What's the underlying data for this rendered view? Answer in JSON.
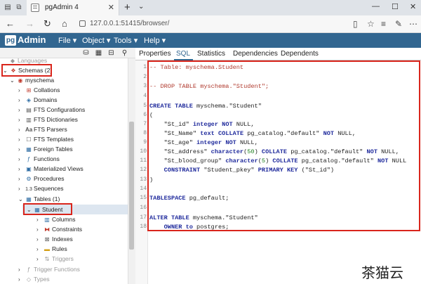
{
  "browser": {
    "tab_title": "pgAdmin 4",
    "url": "127.0.0.1:51415/browser/"
  },
  "app": {
    "logo_box": "pg",
    "logo_text": "Admin",
    "menus": [
      "File",
      "Object",
      "Tools",
      "Help"
    ]
  },
  "tree": {
    "top_item": "Languages",
    "schemas_label": "Schemas (2)",
    "schema_name": "myschema",
    "items": [
      {
        "label": "Collations",
        "icon": "collation-icon"
      },
      {
        "label": "Domains",
        "icon": "domain-icon"
      },
      {
        "label": "FTS Configurations",
        "icon": "fts-config-icon"
      },
      {
        "label": "FTS Dictionaries",
        "icon": "fts-dict-icon"
      },
      {
        "label": "FTS Parsers",
        "icon": "fts-parser-icon"
      },
      {
        "label": "FTS Templates",
        "icon": "fts-template-icon"
      },
      {
        "label": "Foreign Tables",
        "icon": "foreign-table-icon"
      },
      {
        "label": "Functions",
        "icon": "function-icon"
      },
      {
        "label": "Materialized Views",
        "icon": "mview-icon"
      },
      {
        "label": "Procedures",
        "icon": "procedure-icon"
      },
      {
        "label": "Sequences",
        "icon": "sequence-icon"
      }
    ],
    "tables_label": "Tables (1)",
    "table_name": "Student",
    "table_children": [
      "Columns",
      "Constraints",
      "Indexes",
      "Rules",
      "Triggers"
    ],
    "bottom_items": [
      "Trigger Functions",
      "Types"
    ]
  },
  "panel": {
    "tabs": [
      "Properties",
      "SQL",
      "Statistics",
      "Dependencies",
      "Dependents"
    ],
    "active_tab": "SQL"
  },
  "sql": {
    "line_numbers": [
      "1",
      "2",
      "3",
      "4",
      "5",
      "6",
      "7",
      "8",
      "9",
      "10",
      "11",
      "12",
      "13",
      "14",
      "15",
      "16",
      "17",
      "18"
    ],
    "line1": "-- Table: myschema.Student",
    "line3": "-- DROP TABLE myschema.\"Student\";",
    "line5_kw": "CREATE TABLE",
    "line5_rest": " myschema.\"Student\"",
    "line6": "(",
    "col1_name": "    \"St_id\" ",
    "col1_type": "integer",
    "col1_nn": " NOT",
    "col1_end": " NULL,",
    "col2_name": "    \"St_Name\" ",
    "col2_type": "text",
    "col2_coll": " COLLATE",
    "col2_mid": " pg_catalog.\"default\" ",
    "col2_nn": "NOT",
    "col2_end": " NULL,",
    "col3_name": "    \"St_age\" ",
    "col3_type": "integer",
    "col3_nn": " NOT",
    "col3_end": " NULL,",
    "col4_name": "    \"St_address\" ",
    "col4_type": "character",
    "col4_paren_open": "(",
    "col4_len": "50",
    "col4_paren_close": ")",
    "col4_coll": " COLLATE",
    "col4_mid": " pg_catalog.\"default\" ",
    "col4_nn": "NOT",
    "col4_end": " NULL,",
    "col5_name": "    \"St_blood_group\" ",
    "col5_type": "character",
    "col5_paren_open": "(",
    "col5_len": "5",
    "col5_paren_close": ")",
    "col5_coll": " COLLATE",
    "col5_mid": " pg_catalog.\"default\" ",
    "col5_nn": "NOT",
    "col5_end": " NULL",
    "con_kw": "    CONSTRAINT",
    "con_name": " \"Student_pkey\" ",
    "con_pk": "PRIMARY KEY",
    "con_cols": " (\"St_id\")",
    "line13": ")",
    "line15_kw": "TABLESPACE",
    "line15_rest": " pg_default;",
    "line17_kw": "ALTER TABLE",
    "line17_rest": " myschema.\"Student\"",
    "line18_kw": "    OWNER to",
    "line18_rest": " postgres;"
  },
  "watermark": "茶猫云",
  "colors": {
    "brand": "#326690",
    "highlight": "#d9251c"
  }
}
